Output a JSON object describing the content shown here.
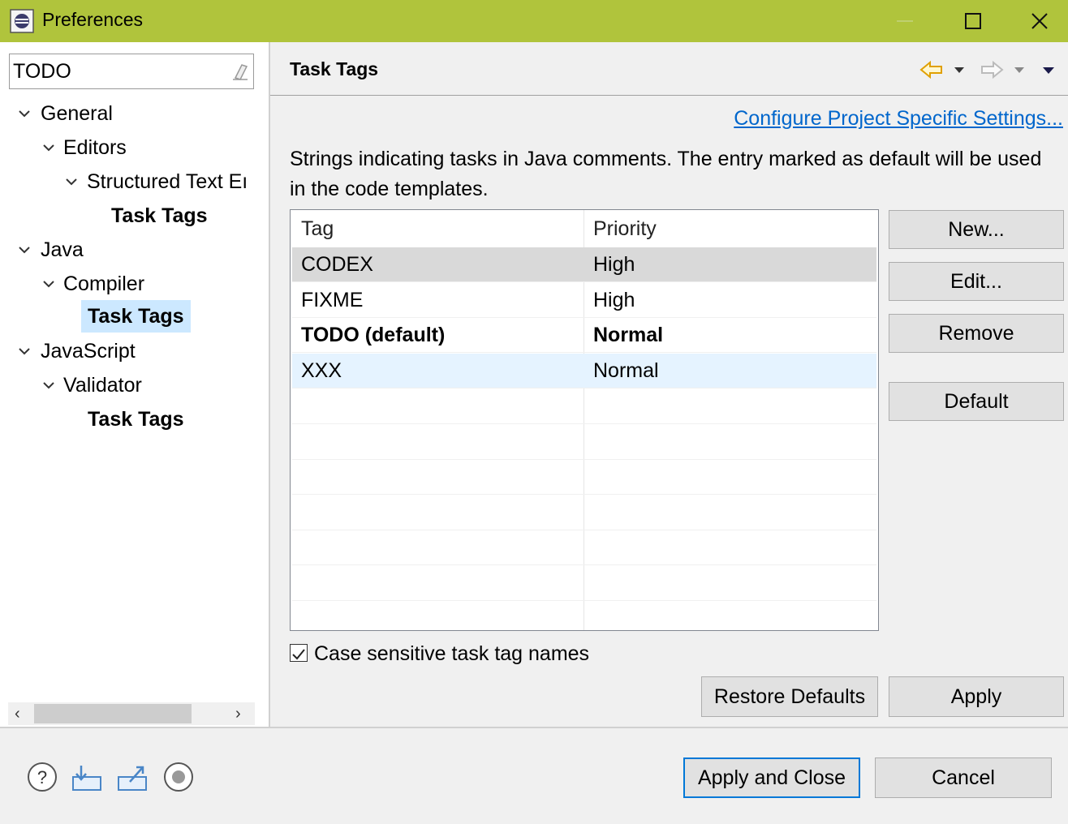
{
  "window": {
    "title": "Preferences",
    "titlebar_color": "#b0c43c"
  },
  "filter": {
    "value": "TODO"
  },
  "tree": {
    "general": "General",
    "editors": "Editors",
    "structured_text": "Structured Text Eı",
    "task_tags_1": "Task Tags",
    "java": "Java",
    "compiler": "Compiler",
    "task_tags_2": "Task Tags",
    "javascript": "JavaScript",
    "validator": "Validator",
    "task_tags_3": "Task Tags"
  },
  "page": {
    "title": "Task Tags",
    "configure_link": "Configure Project Specific Settings...",
    "description": "Strings indicating tasks in Java comments. The entry marked as default will be used in the code templates."
  },
  "table": {
    "headers": [
      "Tag",
      "Priority"
    ],
    "rows": [
      {
        "tag": "CODEX",
        "priority": "High"
      },
      {
        "tag": "FIXME",
        "priority": "High"
      },
      {
        "tag": "TODO (default)",
        "priority": "Normal"
      },
      {
        "tag": "XXX",
        "priority": "Normal"
      }
    ]
  },
  "buttons": {
    "new": "New...",
    "edit": "Edit...",
    "remove": "Remove",
    "default": "Default",
    "restore_defaults": "Restore Defaults",
    "apply": "Apply",
    "apply_close": "Apply and Close",
    "cancel": "Cancel"
  },
  "checkbox": {
    "label": "Case sensitive task tag names",
    "checked": true
  },
  "colors": {
    "link": "#0066cc",
    "selection": "#cce8ff",
    "focus_border": "#0078d7"
  }
}
